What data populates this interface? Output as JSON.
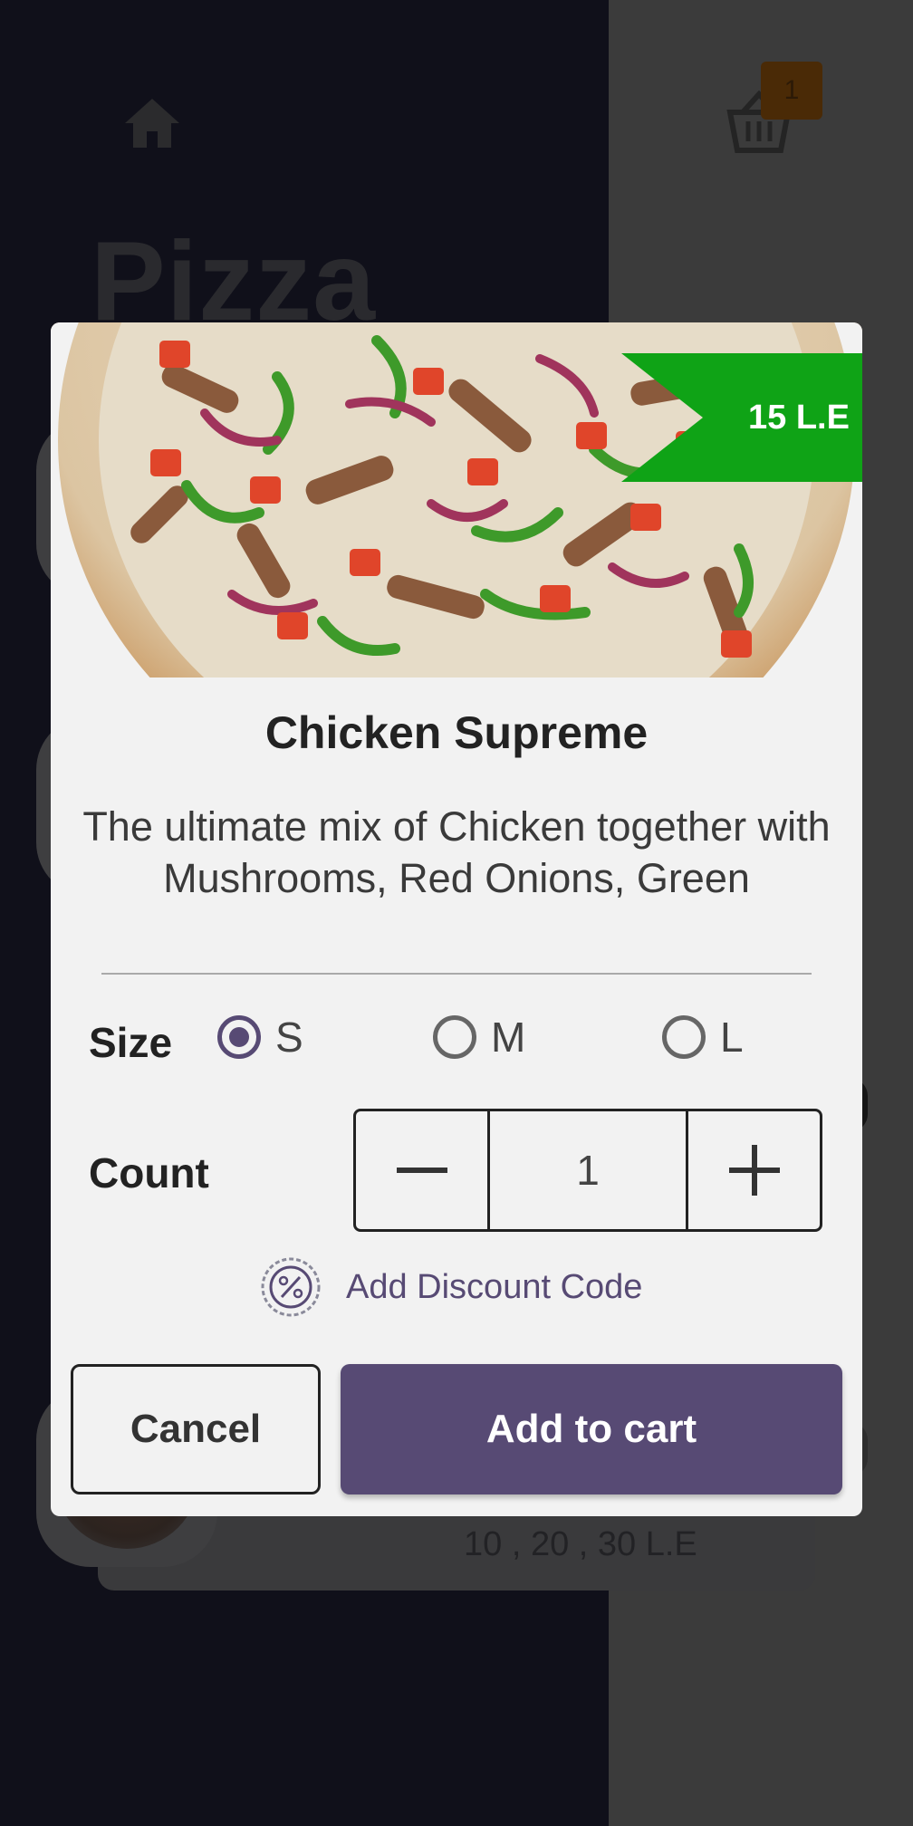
{
  "background": {
    "title": "Pizza",
    "cart_count": "1",
    "price_text": "10 , 20 , 30 L.E"
  },
  "icons": {
    "home": "home-icon",
    "cart": "basket-icon",
    "discount": "percent-badge-icon",
    "minus": "minus-icon",
    "plus": "plus-icon"
  },
  "dialog": {
    "price_badge": "15 L.E",
    "title": "Chicken Supreme",
    "description": "The ultimate mix of Chicken together with Mushrooms, Red Onions, Green Peppers, fresh Tomatoes, Olives and",
    "size_label": "Size",
    "sizes": [
      {
        "label": "S",
        "selected": true
      },
      {
        "label": "M",
        "selected": false
      },
      {
        "label": "L",
        "selected": false
      }
    ],
    "count_label": "Count",
    "count_value": "1",
    "discount_label": "Add Discount Code",
    "cancel_label": "Cancel",
    "add_label": "Add to cart"
  },
  "colors": {
    "accent": "#574a74",
    "price_badge": "#0fa316",
    "overlay_dark": "#10101a"
  }
}
